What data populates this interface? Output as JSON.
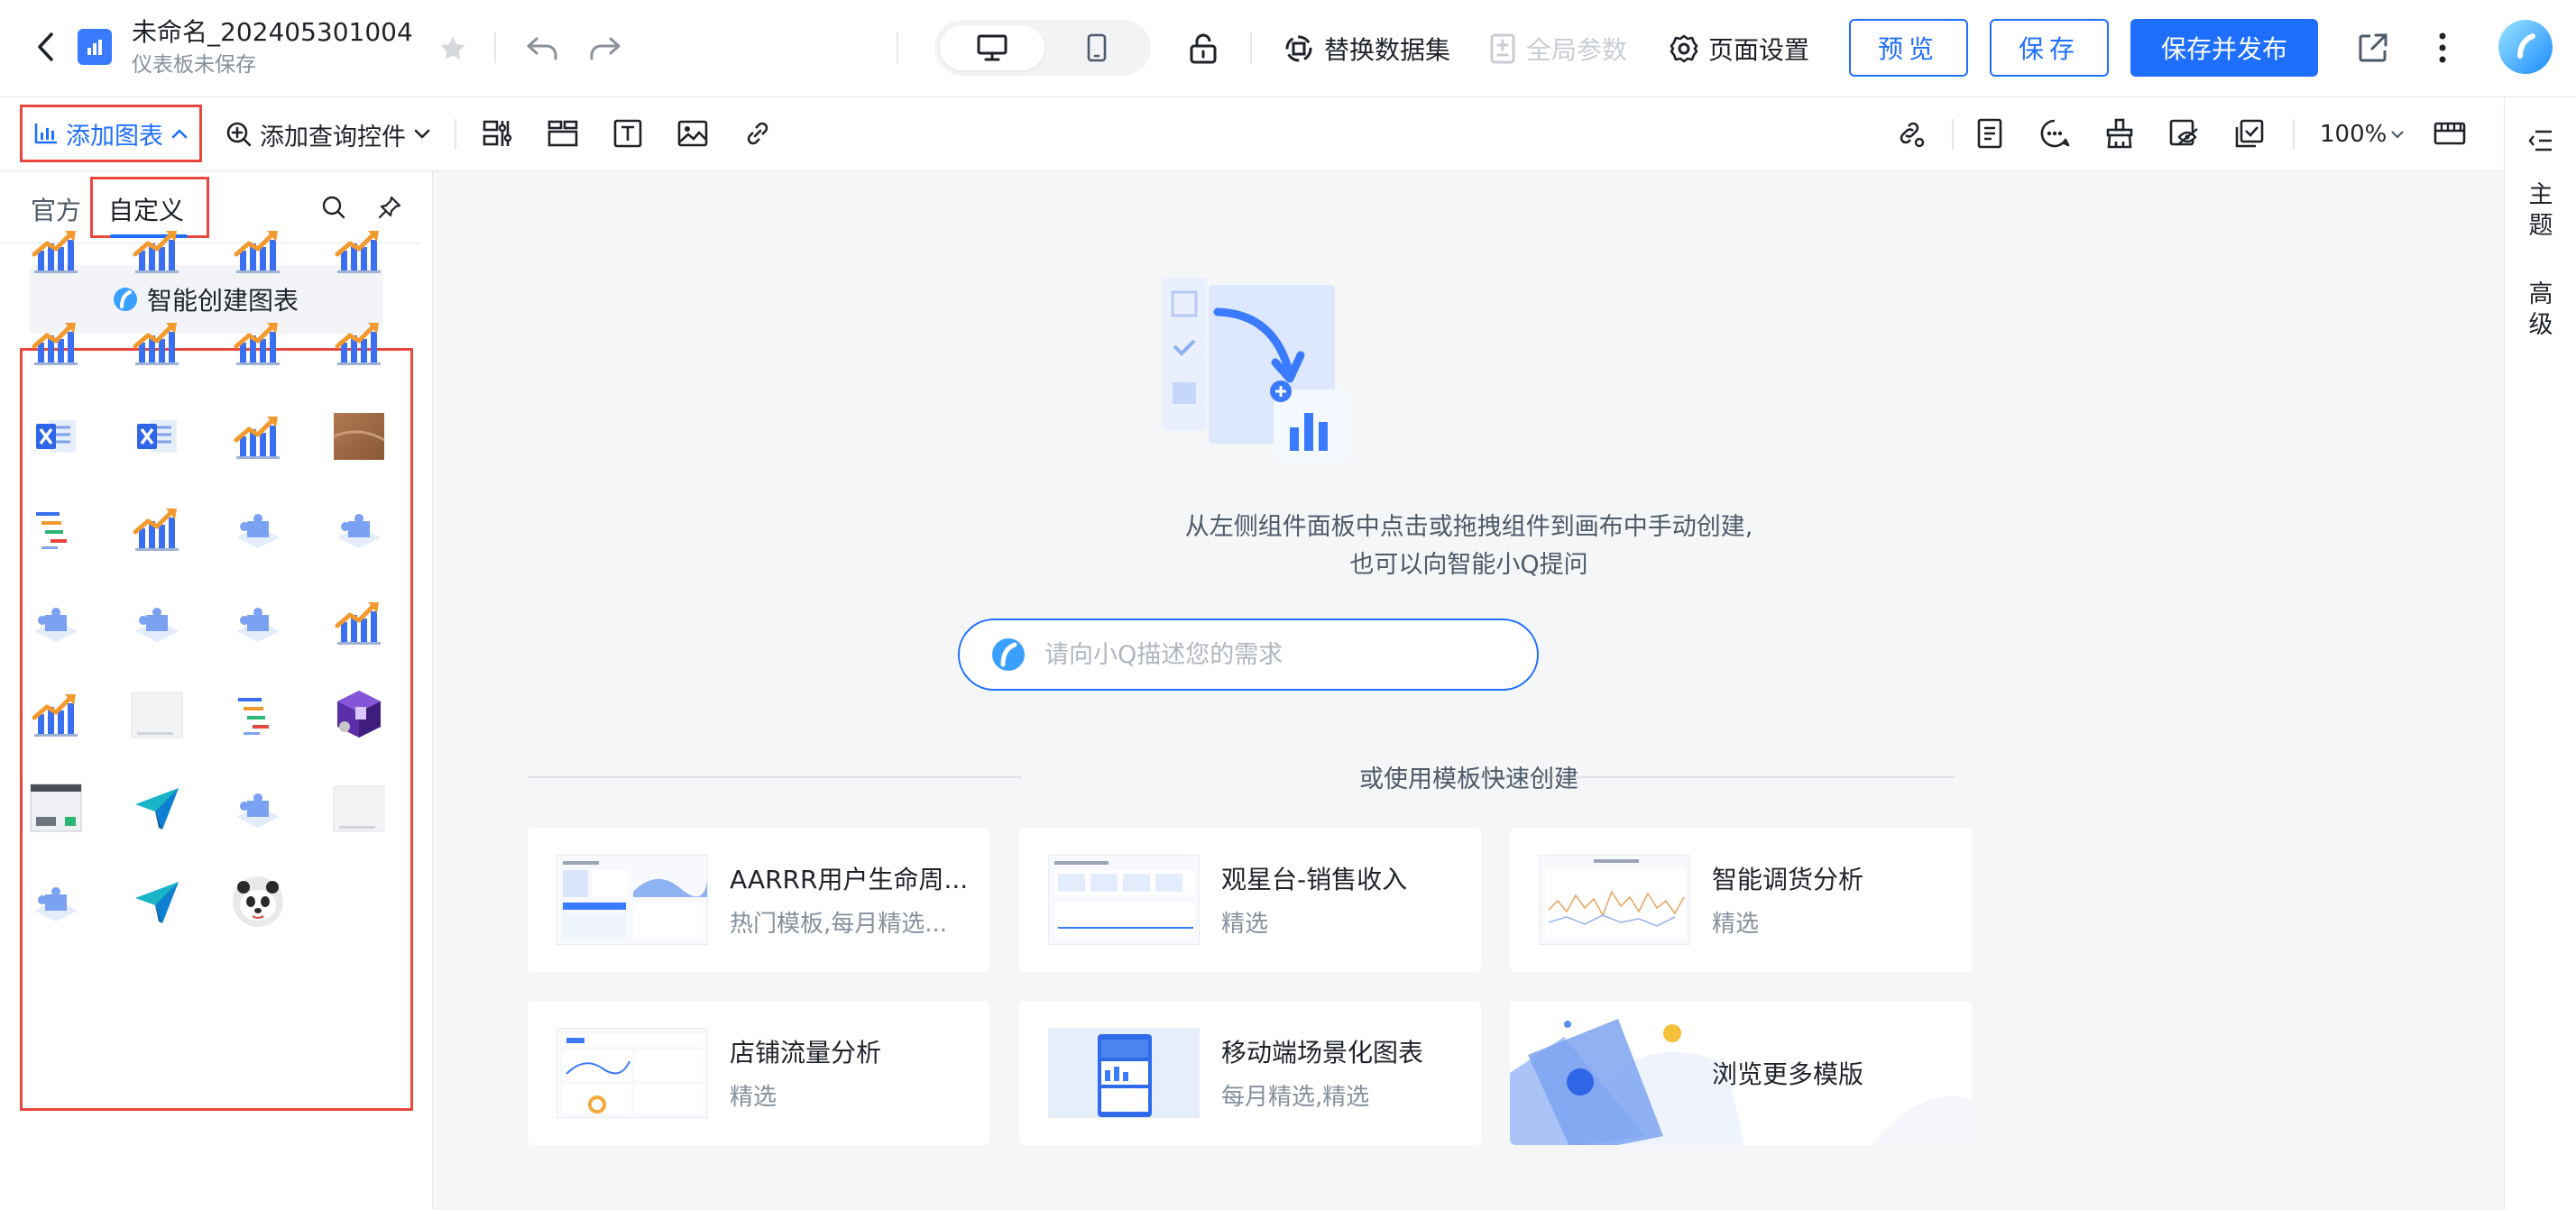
{
  "header": {
    "title": "未命名_202405301004",
    "subtitle": "仪表板未保存",
    "replace_dataset": "替换数据集",
    "global_params": "全局参数",
    "page_settings": "页面设置",
    "preview": "预览",
    "save": "保存",
    "save_publish": "保存并发布",
    "brand_color": "#1f6fff"
  },
  "toolbar": {
    "add_chart": "添加图表",
    "add_query": "添加查询控件",
    "zoom": "100%"
  },
  "panel": {
    "tab_official": "官方",
    "tab_custom": "自定义",
    "smart_create": "智能创建图表",
    "custom_items": [
      "bar-chart-icon",
      "bar-chart-icon",
      "bar-chart-icon",
      "bar-chart-icon",
      "bar-chart-icon",
      "bar-chart-icon",
      "bar-chart-icon",
      "bar-chart-icon",
      "excel-icon",
      "excel-icon",
      "bar-chart-icon",
      "photo-thumbnail",
      "gantt-icon",
      "bar-chart-icon",
      "puzzle-icon",
      "puzzle-icon",
      "puzzle-icon",
      "puzzle-icon",
      "puzzle-icon",
      "bar-chart-icon",
      "bar-chart-icon",
      "blank-thumbnail",
      "gantt-icon",
      "cube-icon",
      "screenshot-thumbnail",
      "paper-plane-icon",
      "puzzle-icon",
      "blank-thumbnail",
      "puzzle-icon",
      "paper-plane-icon",
      "panda-icon"
    ]
  },
  "canvas": {
    "hint_line1": "从左侧组件面板中点击或拖拽组件到画布中手动创建,",
    "hint_line2": "也可以向智能小Q提问",
    "ask_placeholder": "请向小Q描述您的需求",
    "or_template": "或使用模板快速创建",
    "templates": [
      {
        "name": "AARRR用户生命周...",
        "sub": "热门模板,每月精选..."
      },
      {
        "name": "观星台-销售收入",
        "sub": "精选"
      },
      {
        "name": "智能调货分析",
        "sub": "精选"
      },
      {
        "name": "店铺流量分析",
        "sub": "精选"
      },
      {
        "name": "移动端场景化图表",
        "sub": "每月精选,精选"
      }
    ],
    "browse_more": "浏览更多模版"
  },
  "right_rail": {
    "theme": "主题",
    "advanced": "高级"
  }
}
